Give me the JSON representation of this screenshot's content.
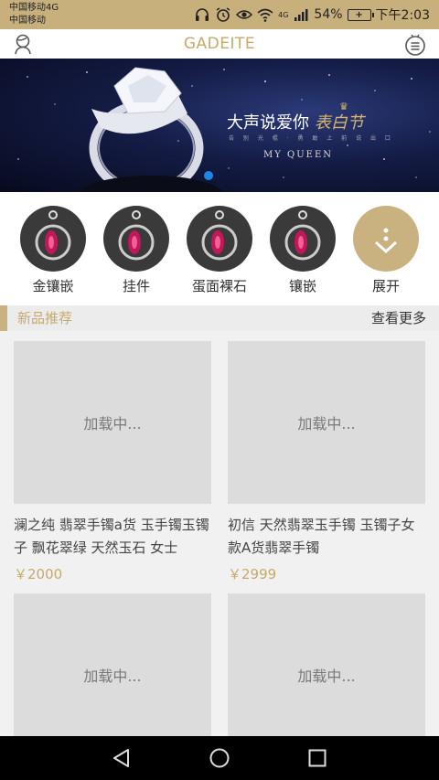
{
  "status_bar": {
    "carrier1": "中国移动4G",
    "carrier2": "中国移动",
    "network_tag": "4G",
    "battery": "54%",
    "time": "下午2:03",
    "icons": [
      "headphones-icon",
      "alarm-icon",
      "eye-icon",
      "wifi-icon",
      "signal-icon",
      "battery-icon"
    ]
  },
  "header": {
    "title": "GADEITE",
    "left_icon": "user-icon",
    "right_icon": "menu-icon"
  },
  "banner": {
    "headline": "大声说爱你",
    "headline_accent": "表白节",
    "subline": "告 别 光 棍 · 勇 敢 上 前 说 出 口",
    "brand": "MY QUEEN"
  },
  "categories": [
    {
      "label": "金镶嵌"
    },
    {
      "label": "挂件"
    },
    {
      "label": "蛋面裸石"
    },
    {
      "label": "镶嵌"
    },
    {
      "label": "展开"
    }
  ],
  "section": {
    "title": "新品推荐",
    "more": "查看更多"
  },
  "products": [
    {
      "image_text": "加载中...",
      "name": "澜之纯 翡翠手镯a货 玉手镯玉镯子 飘花翠绿 天然玉石 女士",
      "price": "￥2000"
    },
    {
      "image_text": "加载中...",
      "name": "初信 天然翡翠玉手镯 玉镯子女款A货翡翠手镯",
      "price": "￥2999"
    },
    {
      "image_text": "加载中...",
      "name": "",
      "price": ""
    },
    {
      "image_text": "加载中...",
      "name": "",
      "price": ""
    }
  ],
  "nav": {
    "icons": [
      "back-icon",
      "home-icon",
      "recents-icon"
    ]
  },
  "colors": {
    "accent": "#c7a96a",
    "status_bar": "#c8b07d",
    "placeholder": "#dcdcdc"
  }
}
